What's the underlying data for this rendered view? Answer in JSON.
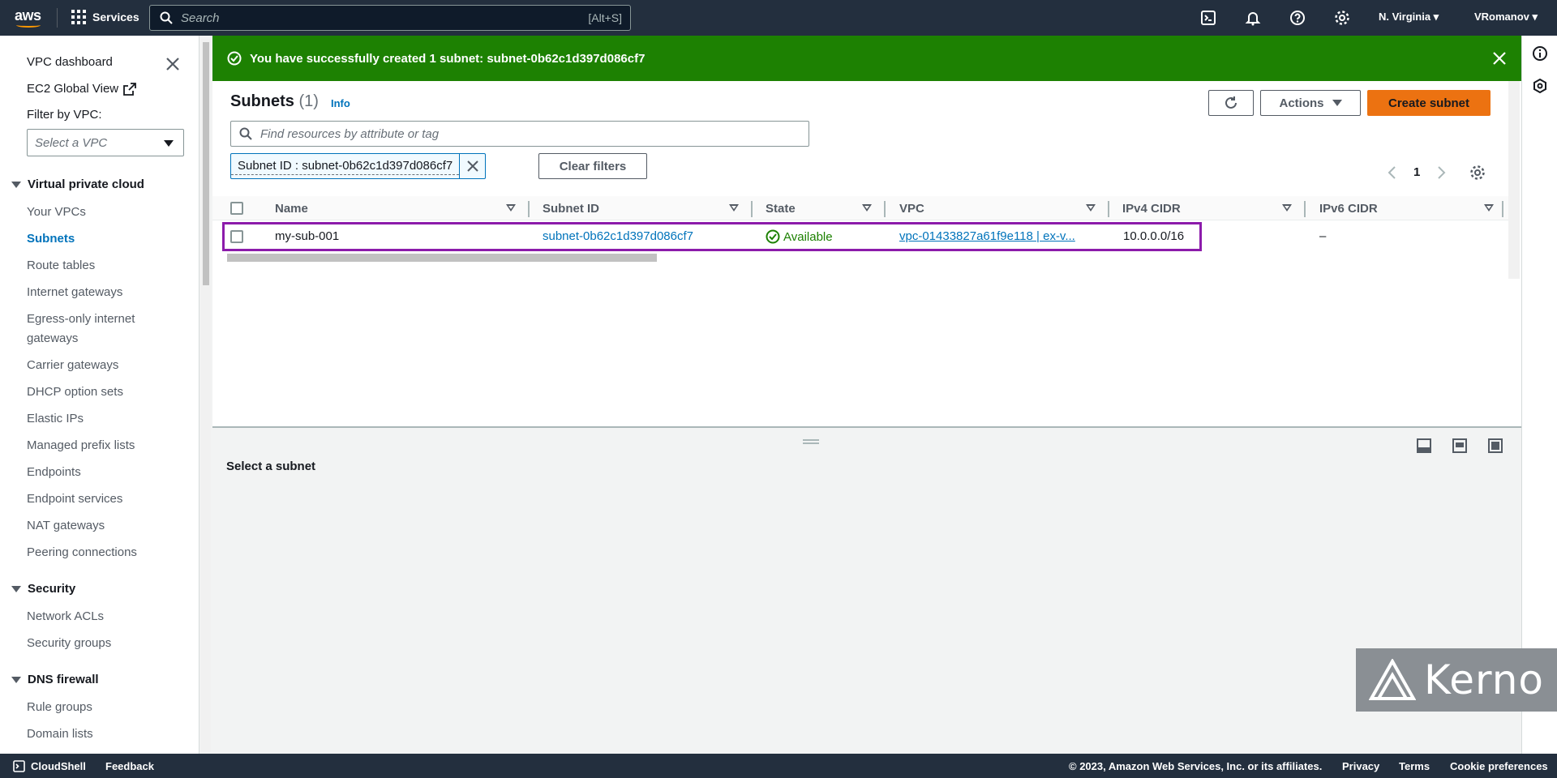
{
  "topnav": {
    "logo": "aws",
    "services": "Services",
    "search_placeholder": "Search",
    "search_shortcut": "[Alt+S]",
    "region": "N. Virginia ▾",
    "user": "VRomanov ▾"
  },
  "sidebar": {
    "top_links": [
      "VPC dashboard",
      "EC2 Global View"
    ],
    "filter_label": "Filter by VPC:",
    "vpc_select_placeholder": "Select a VPC",
    "sections": [
      {
        "heading": "Virtual private cloud",
        "items": [
          "Your VPCs",
          "Subnets",
          "Route tables",
          "Internet gateways",
          "Egress-only internet",
          "gateways",
          "Carrier gateways",
          "DHCP option sets",
          "Elastic IPs",
          "Managed prefix lists",
          "Endpoints",
          "Endpoint services",
          "NAT gateways",
          "Peering connections"
        ]
      },
      {
        "heading": "Security",
        "items": [
          "Network ACLs",
          "Security groups"
        ]
      },
      {
        "heading": "DNS firewall",
        "items": [
          "Rule groups",
          "Domain lists"
        ]
      }
    ],
    "active_item": "Subnets"
  },
  "flash": {
    "message": "You have successfully created 1 subnet: subnet-0b62c1d397d086cf7"
  },
  "main": {
    "title": "Subnets",
    "count": "(1)",
    "info": "Info",
    "actions_label": "Actions",
    "create_label": "Create subnet",
    "filter_placeholder": "Find resources by attribute or tag",
    "token": "Subnet ID : subnet-0b62c1d397d086cf7",
    "clear_filters": "Clear filters",
    "page": "1",
    "columns": [
      "Name",
      "Subnet ID",
      "State",
      "VPC",
      "IPv4 CIDR",
      "IPv6 CIDR"
    ],
    "rows": [
      {
        "name": "my-sub-001",
        "subnet_id": "subnet-0b62c1d397d086cf7",
        "state": "Available",
        "vpc": "vpc-01433827a61f9e118 | ex-v...",
        "ipv4": "10.0.0.0/16",
        "ipv6": "–"
      }
    ]
  },
  "lower_panel": {
    "title": "Select a subnet"
  },
  "watermark": "Kerno",
  "footer": {
    "cloudshell": "CloudShell",
    "feedback": "Feedback",
    "copyright": "© 2023, Amazon Web Services, Inc. or its affiliates.",
    "privacy": "Privacy",
    "terms": "Terms",
    "cookies": "Cookie preferences"
  },
  "colors": {
    "nav_bg": "#232f3e",
    "flash_green": "#1d8102",
    "primary_orange": "#ec7211",
    "link_blue": "#0073bb",
    "highlight_purple": "#8c1bab"
  }
}
